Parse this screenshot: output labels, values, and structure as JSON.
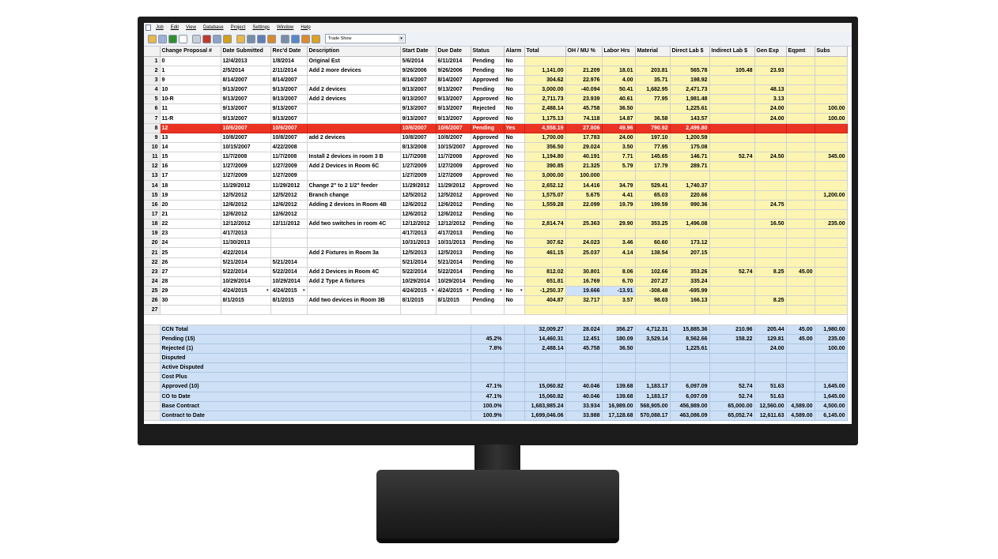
{
  "menu": [
    "Job",
    "Edit",
    "View",
    "Database",
    "Project",
    "Settings",
    "Window",
    "Help"
  ],
  "toolbar": {
    "icons": [
      "open-icon",
      "save-icon",
      "money-icon",
      "document-icon",
      "copy-icon",
      "delete-icon",
      "card-icon",
      "key-icon",
      "folder-icon",
      "print-icon",
      "link-icon",
      "tools-icon",
      "report-icon",
      "chart-icon",
      "settings-icon",
      "help-icon"
    ],
    "profile_select": "Trade Show"
  },
  "columns": [
    "Change Proposal #",
    "Date Submitted",
    "Rec'd Date",
    "Description",
    "Start Date",
    "Due Date",
    "Status",
    "Alarm",
    "Total",
    "OH / MU %",
    "Labor Hrs",
    "Material",
    "Direct Lab $",
    "Indirect Lab $",
    "Gen Exp",
    "Eqpmt",
    "Subs"
  ],
  "rows": [
    [
      "1",
      "0",
      "12/4/2013",
      "1/8/2014",
      "Original Est",
      "5/6/2014",
      "6/11/2014",
      "Pending",
      "No",
      "",
      "",
      "",
      "",
      "",
      "",
      "",
      "",
      ""
    ],
    [
      "2",
      "1",
      "2/5/2014",
      "2/11/2014",
      "Add 2 more devices",
      "9/26/2006",
      "9/26/2006",
      "Pending",
      "No",
      "1,141.00",
      "21.209",
      "18.01",
      "203.81",
      "565.78",
      "105.48",
      "23.93",
      "",
      ""
    ],
    [
      "3",
      "9",
      "8/14/2007",
      "8/14/2007",
      "",
      "8/14/2007",
      "8/14/2007",
      "Approved",
      "No",
      "304.62",
      "22.976",
      "4.00",
      "35.71",
      "198.92",
      "",
      "",
      "",
      ""
    ],
    [
      "4",
      "10",
      "9/13/2007",
      "9/13/2007",
      "Add 2 devices",
      "9/13/2007",
      "9/13/2007",
      "Pending",
      "No",
      "3,000.00",
      "-40.094",
      "50.41",
      "1,682.95",
      "2,471.73",
      "",
      "48.13",
      "",
      ""
    ],
    [
      "5",
      "10-R",
      "9/13/2007",
      "9/13/2007",
      "Add 2 devices",
      "9/13/2007",
      "9/13/2007",
      "Approved",
      "No",
      "2,711.73",
      "23.939",
      "40.61",
      "77.95",
      "1,981.48",
      "",
      "3.13",
      "",
      ""
    ],
    [
      "6",
      "11",
      "9/13/2007",
      "9/13/2007",
      "",
      "9/13/2007",
      "9/13/2007",
      "Rejected",
      "No",
      "2,488.14",
      "45.758",
      "36.50",
      "",
      "1,225.61",
      "",
      "24.00",
      "",
      "100.00"
    ],
    [
      "7",
      "11-R",
      "9/13/2007",
      "9/13/2007",
      "",
      "9/13/2007",
      "9/13/2007",
      "Approved",
      "No",
      "1,175.13",
      "74.118",
      "14.87",
      "36.58",
      "143.57",
      "",
      "24.00",
      "",
      "100.00"
    ],
    [
      "8",
      "12",
      "10/6/2007",
      "10/6/2007",
      "",
      "10/6/2007",
      "10/6/2007",
      "Pending",
      "Yes",
      "4,558.19",
      "27.806",
      "49.96",
      "790.92",
      "2,499.80",
      "",
      "",
      "",
      ""
    ],
    [
      "9",
      "13",
      "10/8/2007",
      "10/8/2007",
      "add 2 devices",
      "10/8/2007",
      "10/8/2007",
      "Approved",
      "No",
      "1,700.00",
      "17.783",
      "24.00",
      "197.10",
      "1,200.59",
      "",
      "",
      "",
      ""
    ],
    [
      "10",
      "14",
      "10/15/2007",
      "4/22/2008",
      "",
      "8/13/2008",
      "10/15/2007",
      "Approved",
      "No",
      "356.50",
      "29.024",
      "3.50",
      "77.95",
      "175.08",
      "",
      "",
      "",
      ""
    ],
    [
      "11",
      "15",
      "11/7/2008",
      "11/7/2008",
      "Install 2 devices in room 3 B",
      "11/7/2008",
      "11/7/2008",
      "Approved",
      "No",
      "1,194.80",
      "40.191",
      "7.71",
      "145.65",
      "146.71",
      "52.74",
      "24.50",
      "",
      "345.00"
    ],
    [
      "12",
      "16",
      "1/27/2009",
      "1/27/2009",
      "Add 2 Devices in Room 6C",
      "1/27/2009",
      "1/27/2009",
      "Approved",
      "No",
      "390.85",
      "21.325",
      "5.79",
      "17.79",
      "289.71",
      "",
      "",
      "",
      ""
    ],
    [
      "13",
      "17",
      "1/27/2009",
      "1/27/2009",
      "",
      "1/27/2009",
      "1/27/2009",
      "Approved",
      "No",
      "3,000.00",
      "100.000",
      "",
      "",
      "",
      "",
      "",
      "",
      ""
    ],
    [
      "14",
      "18",
      "11/29/2012",
      "11/29/2012",
      "Change 2\" to 2 1/2\" feeder",
      "11/29/2012",
      "11/29/2012",
      "Approved",
      "No",
      "2,652.12",
      "14.416",
      "34.79",
      "529.41",
      "1,740.37",
      "",
      "",
      "",
      ""
    ],
    [
      "15",
      "19",
      "12/5/2012",
      "12/5/2012",
      "Branch change",
      "12/5/2012",
      "12/5/2012",
      "Approved",
      "No",
      "1,575.07",
      "5.675",
      "4.41",
      "65.03",
      "220.66",
      "",
      "",
      "",
      "1,200.00"
    ],
    [
      "16",
      "20",
      "12/6/2012",
      "12/6/2012",
      "Adding 2 devices in Room 4B",
      "12/6/2012",
      "12/6/2012",
      "Pending",
      "No",
      "1,559.28",
      "22.099",
      "19.79",
      "199.59",
      "990.36",
      "",
      "24.75",
      "",
      ""
    ],
    [
      "17",
      "21",
      "12/6/2012",
      "12/6/2012",
      "",
      "12/6/2012",
      "12/6/2012",
      "Pending",
      "No",
      "",
      "",
      "",
      "",
      "",
      "",
      "",
      "",
      ""
    ],
    [
      "18",
      "22",
      "12/12/2012",
      "12/11/2012",
      "Add two switches in room 4C",
      "12/12/2012",
      "12/12/2012",
      "Pending",
      "No",
      "2,814.74",
      "25.363",
      "29.90",
      "353.25",
      "1,496.08",
      "",
      "16.50",
      "",
      "235.00"
    ],
    [
      "19",
      "23",
      "4/17/2013",
      "",
      "",
      "4/17/2013",
      "4/17/2013",
      "Pending",
      "No",
      "",
      "",
      "",
      "",
      "",
      "",
      "",
      "",
      ""
    ],
    [
      "20",
      "24",
      "11/30/2013",
      "",
      "",
      "10/31/2013",
      "10/31/2013",
      "Pending",
      "No",
      "307.62",
      "24.023",
      "3.46",
      "60.60",
      "173.12",
      "",
      "",
      "",
      ""
    ],
    [
      "21",
      "25",
      "4/22/2014",
      "",
      "Add 2 Fixtures in Room 3a",
      "12/5/2013",
      "12/5/2013",
      "Pending",
      "No",
      "461.15",
      "25.037",
      "4.14",
      "138.54",
      "207.15",
      "",
      "",
      "",
      ""
    ],
    [
      "22",
      "26",
      "5/21/2014",
      "5/21/2014",
      "",
      "5/21/2014",
      "5/21/2014",
      "Pending",
      "No",
      "",
      "",
      "",
      "",
      "",
      "",
      "",
      "",
      ""
    ],
    [
      "23",
      "27",
      "5/22/2014",
      "5/22/2014",
      "Add 2 Devices in Room 4C",
      "5/22/2014",
      "5/22/2014",
      "Pending",
      "No",
      "812.02",
      "30.801",
      "8.06",
      "102.66",
      "353.26",
      "52.74",
      "8.25",
      "45.00",
      ""
    ],
    [
      "24",
      "28",
      "10/29/2014",
      "10/29/2014",
      "Add 2 Type A fixtures",
      "10/29/2014",
      "10/29/2014",
      "Pending",
      "No",
      "651.81",
      "16.769",
      "6.70",
      "207.27",
      "335.24",
      "",
      "",
      "",
      ""
    ],
    [
      "25",
      "29",
      "4/24/2015",
      "4/24/2015",
      "",
      "4/24/2015",
      "4/24/2015",
      "Pending",
      "No",
      "-1,250.37",
      "19.666",
      "-13.91",
      "-308.48",
      "-695.99",
      "",
      "",
      "",
      ""
    ],
    [
      "26",
      "30",
      "8/1/2015",
      "8/1/2015",
      "Add two devices in Room 3B",
      "8/1/2015",
      "8/1/2015",
      "Pending",
      "No",
      "404.87",
      "32.717",
      "3.57",
      "98.03",
      "166.13",
      "",
      "8.25",
      "",
      ""
    ],
    [
      "27",
      "",
      "",
      "",
      "",
      "",
      "",
      "",
      "",
      "",
      "",
      "",
      "",
      "",
      "",
      "",
      "",
      ""
    ]
  ],
  "summary": [
    [
      "CCN Total",
      "",
      "32,009.27",
      "28.024",
      "356.27",
      "4,712.31",
      "15,885.36",
      "210.96",
      "205.44",
      "45.00",
      "1,980.00"
    ],
    [
      "Pending (15)",
      "45.2%",
      "14,460.31",
      "12.451",
      "180.09",
      "3,529.14",
      "8,562.66",
      "158.22",
      "129.81",
      "45.00",
      "235.00"
    ],
    [
      "Rejected (1)",
      "7.8%",
      "2,488.14",
      "45.758",
      "36.50",
      "",
      "1,225.61",
      "",
      "24.00",
      "",
      "100.00"
    ],
    [
      "Disputed",
      "",
      "",
      "",
      "",
      "",
      "",
      "",
      "",
      "",
      ""
    ],
    [
      "Active Disputed",
      "",
      "",
      "",
      "",
      "",
      "",
      "",
      "",
      "",
      ""
    ],
    [
      "Cost Plus",
      "",
      "",
      "",
      "",
      "",
      "",
      "",
      "",
      "",
      ""
    ],
    [
      "Approved (10)",
      "47.1%",
      "15,060.82",
      "40.046",
      "139.68",
      "1,183.17",
      "6,097.09",
      "52.74",
      "51.63",
      "",
      "1,645.00"
    ],
    [
      "CO to Date",
      "47.1%",
      "15,060.82",
      "40.046",
      "139.68",
      "1,183.17",
      "6,097.09",
      "52.74",
      "51.63",
      "",
      "1,645.00"
    ],
    [
      "Base Contract",
      "100.0%",
      "1,683,985.24",
      "33.934",
      "16,989.00",
      "568,905.00",
      "456,989.00",
      "65,000.00",
      "12,560.00",
      "4,589.00",
      "4,500.00"
    ],
    [
      "Contract to Date",
      "100.9%",
      "1,699,046.06",
      "33.988",
      "17,128.68",
      "570,088.17",
      "463,086.09",
      "65,052.74",
      "12,611.63",
      "4,589.00",
      "6,145.00"
    ]
  ],
  "colors": {
    "accent_yellow": "#fbf5b1",
    "alarm_red": "#ea3323",
    "summary_blue": "#cde0f5"
  }
}
